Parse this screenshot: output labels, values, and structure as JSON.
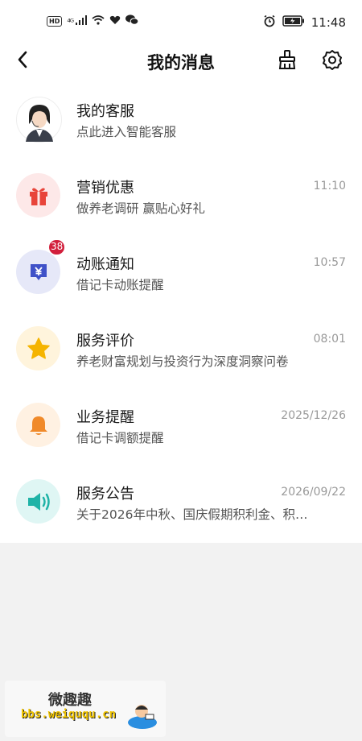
{
  "status_bar": {
    "left_icons": [
      "hd-icon",
      "4g-signal-icon",
      "wifi-icon",
      "heart-icon",
      "wechat-icon"
    ],
    "hd": "HD",
    "net": "⁴ᴳ",
    "right_icons": [
      "alarm-icon",
      "battery-icon"
    ],
    "time": "11:48"
  },
  "header": {
    "title": "我的消息",
    "icons": [
      "back-icon",
      "broom-icon",
      "gear-icon"
    ]
  },
  "messages": [
    {
      "title": "我的客服",
      "subtitle": "点此进入智能客服",
      "time": "",
      "icon": "agent-avatar",
      "bg": "#ffffff"
    },
    {
      "title": "营销优惠",
      "subtitle": "做养老调研 赢贴心好礼",
      "time": "11:10",
      "icon": "gift-icon",
      "bg": "#fde8e8",
      "color": "#e8443a"
    },
    {
      "title": "动账通知",
      "subtitle": "借记卡动账提醒",
      "time": "10:57",
      "icon": "yen-icon",
      "bg": "#e6e8f8",
      "color": "#3f51c8",
      "badge": "38"
    },
    {
      "title": "服务评价",
      "subtitle": "养老财富规划与投资行为深度洞察问卷",
      "time": "08:01",
      "icon": "star-icon",
      "bg": "#fff4dc",
      "color": "#f5b400"
    },
    {
      "title": "业务提醒",
      "subtitle": "借记卡调额提醒",
      "time": "2025/12/26",
      "icon": "bell-icon",
      "bg": "#fff1e2",
      "color": "#f08a2a"
    },
    {
      "title": "服务公告",
      "subtitle": "关于2026年中秋、国庆假期积利金、积…",
      "time": "2026/09/22",
      "icon": "speaker-icon",
      "bg": "#dff6f4",
      "color": "#1fb3a7"
    }
  ],
  "watermark": {
    "text": "微趣趣",
    "url": "bbs.weiququ.cn"
  }
}
